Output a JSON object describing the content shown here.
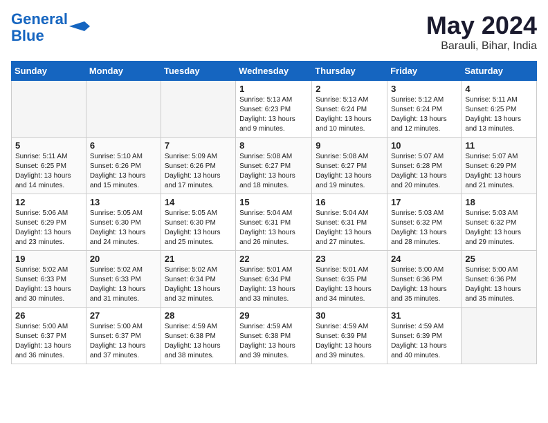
{
  "header": {
    "logo_general": "General",
    "logo_blue": "Blue",
    "month_year": "May 2024",
    "location": "Barauli, Bihar, India"
  },
  "weekdays": [
    "Sunday",
    "Monday",
    "Tuesday",
    "Wednesday",
    "Thursday",
    "Friday",
    "Saturday"
  ],
  "weeks": [
    [
      {
        "day": "",
        "info": ""
      },
      {
        "day": "",
        "info": ""
      },
      {
        "day": "",
        "info": ""
      },
      {
        "day": "1",
        "info": "Sunrise: 5:13 AM\nSunset: 6:23 PM\nDaylight: 13 hours\nand 9 minutes."
      },
      {
        "day": "2",
        "info": "Sunrise: 5:13 AM\nSunset: 6:24 PM\nDaylight: 13 hours\nand 10 minutes."
      },
      {
        "day": "3",
        "info": "Sunrise: 5:12 AM\nSunset: 6:24 PM\nDaylight: 13 hours\nand 12 minutes."
      },
      {
        "day": "4",
        "info": "Sunrise: 5:11 AM\nSunset: 6:25 PM\nDaylight: 13 hours\nand 13 minutes."
      }
    ],
    [
      {
        "day": "5",
        "info": "Sunrise: 5:11 AM\nSunset: 6:25 PM\nDaylight: 13 hours\nand 14 minutes."
      },
      {
        "day": "6",
        "info": "Sunrise: 5:10 AM\nSunset: 6:26 PM\nDaylight: 13 hours\nand 15 minutes."
      },
      {
        "day": "7",
        "info": "Sunrise: 5:09 AM\nSunset: 6:26 PM\nDaylight: 13 hours\nand 17 minutes."
      },
      {
        "day": "8",
        "info": "Sunrise: 5:08 AM\nSunset: 6:27 PM\nDaylight: 13 hours\nand 18 minutes."
      },
      {
        "day": "9",
        "info": "Sunrise: 5:08 AM\nSunset: 6:27 PM\nDaylight: 13 hours\nand 19 minutes."
      },
      {
        "day": "10",
        "info": "Sunrise: 5:07 AM\nSunset: 6:28 PM\nDaylight: 13 hours\nand 20 minutes."
      },
      {
        "day": "11",
        "info": "Sunrise: 5:07 AM\nSunset: 6:29 PM\nDaylight: 13 hours\nand 21 minutes."
      }
    ],
    [
      {
        "day": "12",
        "info": "Sunrise: 5:06 AM\nSunset: 6:29 PM\nDaylight: 13 hours\nand 23 minutes."
      },
      {
        "day": "13",
        "info": "Sunrise: 5:05 AM\nSunset: 6:30 PM\nDaylight: 13 hours\nand 24 minutes."
      },
      {
        "day": "14",
        "info": "Sunrise: 5:05 AM\nSunset: 6:30 PM\nDaylight: 13 hours\nand 25 minutes."
      },
      {
        "day": "15",
        "info": "Sunrise: 5:04 AM\nSunset: 6:31 PM\nDaylight: 13 hours\nand 26 minutes."
      },
      {
        "day": "16",
        "info": "Sunrise: 5:04 AM\nSunset: 6:31 PM\nDaylight: 13 hours\nand 27 minutes."
      },
      {
        "day": "17",
        "info": "Sunrise: 5:03 AM\nSunset: 6:32 PM\nDaylight: 13 hours\nand 28 minutes."
      },
      {
        "day": "18",
        "info": "Sunrise: 5:03 AM\nSunset: 6:32 PM\nDaylight: 13 hours\nand 29 minutes."
      }
    ],
    [
      {
        "day": "19",
        "info": "Sunrise: 5:02 AM\nSunset: 6:33 PM\nDaylight: 13 hours\nand 30 minutes."
      },
      {
        "day": "20",
        "info": "Sunrise: 5:02 AM\nSunset: 6:33 PM\nDaylight: 13 hours\nand 31 minutes."
      },
      {
        "day": "21",
        "info": "Sunrise: 5:02 AM\nSunset: 6:34 PM\nDaylight: 13 hours\nand 32 minutes."
      },
      {
        "day": "22",
        "info": "Sunrise: 5:01 AM\nSunset: 6:34 PM\nDaylight: 13 hours\nand 33 minutes."
      },
      {
        "day": "23",
        "info": "Sunrise: 5:01 AM\nSunset: 6:35 PM\nDaylight: 13 hours\nand 34 minutes."
      },
      {
        "day": "24",
        "info": "Sunrise: 5:00 AM\nSunset: 6:36 PM\nDaylight: 13 hours\nand 35 minutes."
      },
      {
        "day": "25",
        "info": "Sunrise: 5:00 AM\nSunset: 6:36 PM\nDaylight: 13 hours\nand 35 minutes."
      }
    ],
    [
      {
        "day": "26",
        "info": "Sunrise: 5:00 AM\nSunset: 6:37 PM\nDaylight: 13 hours\nand 36 minutes."
      },
      {
        "day": "27",
        "info": "Sunrise: 5:00 AM\nSunset: 6:37 PM\nDaylight: 13 hours\nand 37 minutes."
      },
      {
        "day": "28",
        "info": "Sunrise: 4:59 AM\nSunset: 6:38 PM\nDaylight: 13 hours\nand 38 minutes."
      },
      {
        "day": "29",
        "info": "Sunrise: 4:59 AM\nSunset: 6:38 PM\nDaylight: 13 hours\nand 39 minutes."
      },
      {
        "day": "30",
        "info": "Sunrise: 4:59 AM\nSunset: 6:39 PM\nDaylight: 13 hours\nand 39 minutes."
      },
      {
        "day": "31",
        "info": "Sunrise: 4:59 AM\nSunset: 6:39 PM\nDaylight: 13 hours\nand 40 minutes."
      },
      {
        "day": "",
        "info": ""
      }
    ]
  ]
}
